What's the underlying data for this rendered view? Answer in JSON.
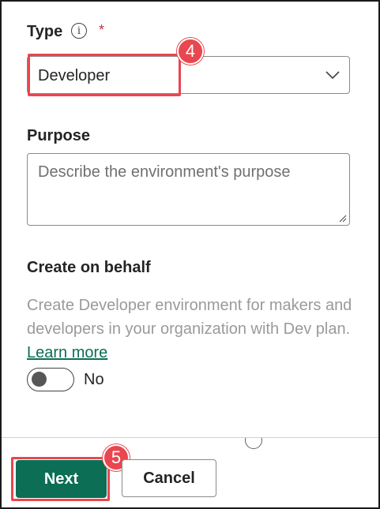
{
  "type_field": {
    "label": "Type",
    "required_mark": "*",
    "selected_value": "Developer"
  },
  "purpose_field": {
    "label": "Purpose",
    "placeholder": "Describe the environment's purpose"
  },
  "create_on_behalf": {
    "label": "Create on behalf",
    "description": "Create Developer environment for makers and developers in your organization with Dev plan.",
    "link_text": "Learn more",
    "toggle_state_label": "No"
  },
  "callouts": {
    "step_type": "4",
    "step_next": "5"
  },
  "footer": {
    "next_label": "Next",
    "cancel_label": "Cancel"
  },
  "colors": {
    "primary": "#0b6e55",
    "callout": "#e8474f",
    "required": "#c4314b"
  },
  "icons": {
    "type_info": "info-icon",
    "select_chevron": "chevron-down-icon",
    "footer_partial": "info-icon"
  }
}
